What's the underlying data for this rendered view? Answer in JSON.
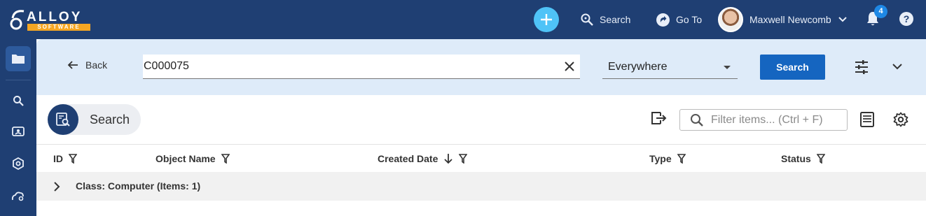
{
  "app": {
    "logo_text": "ALLOY",
    "logo_sub": "SOFTWARE"
  },
  "topbar": {
    "search_label": "Search",
    "goto_label": "Go To",
    "user_name": "Maxwell Newcomb",
    "notification_count": "4",
    "help_glyph": "?"
  },
  "search_bar": {
    "back_label": "Back",
    "query_value": "C000075",
    "scope_value": "Everywhere",
    "search_button": "Search"
  },
  "toolbar": {
    "title": "Search",
    "filter_placeholder": "Filter items... (Ctrl + F)"
  },
  "table": {
    "columns": [
      "ID",
      "Object Name",
      "Created Date",
      "Type",
      "Status"
    ],
    "group_label": "Class: Computer (Items: 1)"
  },
  "colors": {
    "header_bg": "#1f3f73",
    "band_bg": "#deebf9",
    "primary_button": "#1565c0",
    "accent_plus": "#4fc3f7"
  }
}
